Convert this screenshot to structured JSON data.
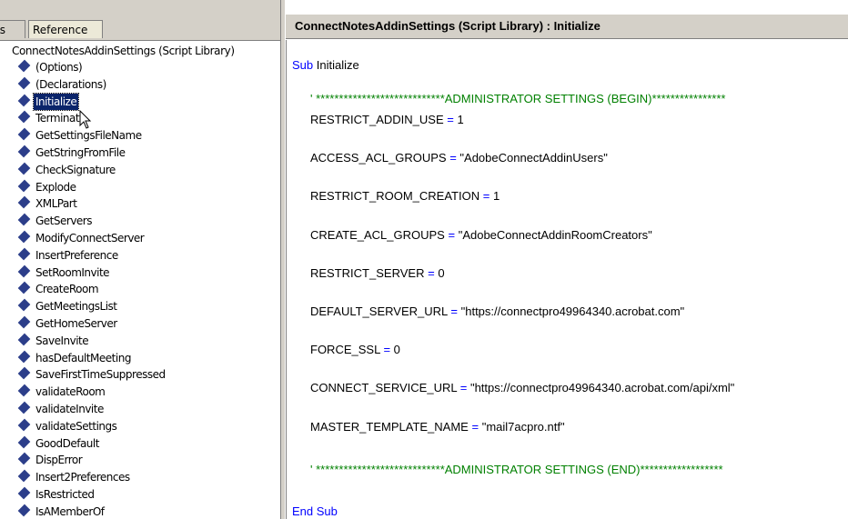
{
  "left_pane": {
    "tabs": [
      {
        "label": "ts"
      },
      {
        "label": "Reference"
      }
    ],
    "root_label": "ConnectNotesAddinSettings (Script Library)",
    "items": [
      {
        "label": "(Options)"
      },
      {
        "label": "(Declarations)"
      },
      {
        "label": "Initialize",
        "selected": true
      },
      {
        "label": "Terminate"
      },
      {
        "label": "GetSettingsFileName"
      },
      {
        "label": "GetStringFromFile"
      },
      {
        "label": "CheckSignature"
      },
      {
        "label": "Explode"
      },
      {
        "label": "XMLPart"
      },
      {
        "label": "GetServers"
      },
      {
        "label": "ModifyConnectServer"
      },
      {
        "label": "InsertPreference"
      },
      {
        "label": "SetRoomInvite"
      },
      {
        "label": "CreateRoom"
      },
      {
        "label": "GetMeetingsList"
      },
      {
        "label": "GetHomeServer"
      },
      {
        "label": "SaveInvite"
      },
      {
        "label": "hasDefaultMeeting"
      },
      {
        "label": "SaveFirstTimeSuppressed"
      },
      {
        "label": "validateRoom"
      },
      {
        "label": "validateInvite"
      },
      {
        "label": "validateSettings"
      },
      {
        "label": "GoodDefault"
      },
      {
        "label": "DispError"
      },
      {
        "label": "Insert2Preferences"
      },
      {
        "label": "IsRestricted"
      },
      {
        "label": "IsAMemberOf"
      }
    ],
    "icon": "method-diamond-icon"
  },
  "editor": {
    "title": "ConnectNotesAddinSettings (Script Library) : Initialize",
    "sub_keyword": "Sub",
    "sub_name": "Initialize",
    "end_sub": "End Sub",
    "comment_begin_prefix": "' ****************************",
    "comment_begin_text": "ADMINISTRATOR SETTINGS (BEGIN)",
    "comment_begin_suffix": "****************",
    "comment_end_prefix": "' ****************************",
    "comment_end_text": "ADMINISTRATOR SETTINGS (END)",
    "comment_end_suffix": "******************",
    "assignments": [
      {
        "name": "RESTRICT_ADDIN_USE",
        "op": "=",
        "value": "1"
      },
      {
        "name": "ACCESS_ACL_GROUPS",
        "op": "=",
        "value": "\"AdobeConnectAddinUsers\""
      },
      {
        "name": "RESTRICT_ROOM_CREATION",
        "op": "=",
        "value": "1"
      },
      {
        "name": "CREATE_ACL_GROUPS",
        "op": "=",
        "value": "\"AdobeConnectAddinRoomCreators\""
      },
      {
        "name": "RESTRICT_SERVER",
        "op": "=",
        "value": "0"
      },
      {
        "name": "DEFAULT_SERVER_URL",
        "op": "=",
        "value": "\"https://connectpro49964340.acrobat.com\""
      },
      {
        "name": "FORCE_SSL",
        "op": "=",
        "value": "0"
      },
      {
        "name": "CONNECT_SERVICE_URL",
        "op": "=",
        "value": "\"https://connectpro49964340.acrobat.com/api/xml\""
      },
      {
        "name": "MASTER_TEMPLATE_NAME",
        "op": "=",
        "value": "\"mail7acpro.ntf\""
      }
    ],
    "colors": {
      "keyword": "#0000ff",
      "comment": "#008000",
      "selection": "#0a246a"
    }
  }
}
